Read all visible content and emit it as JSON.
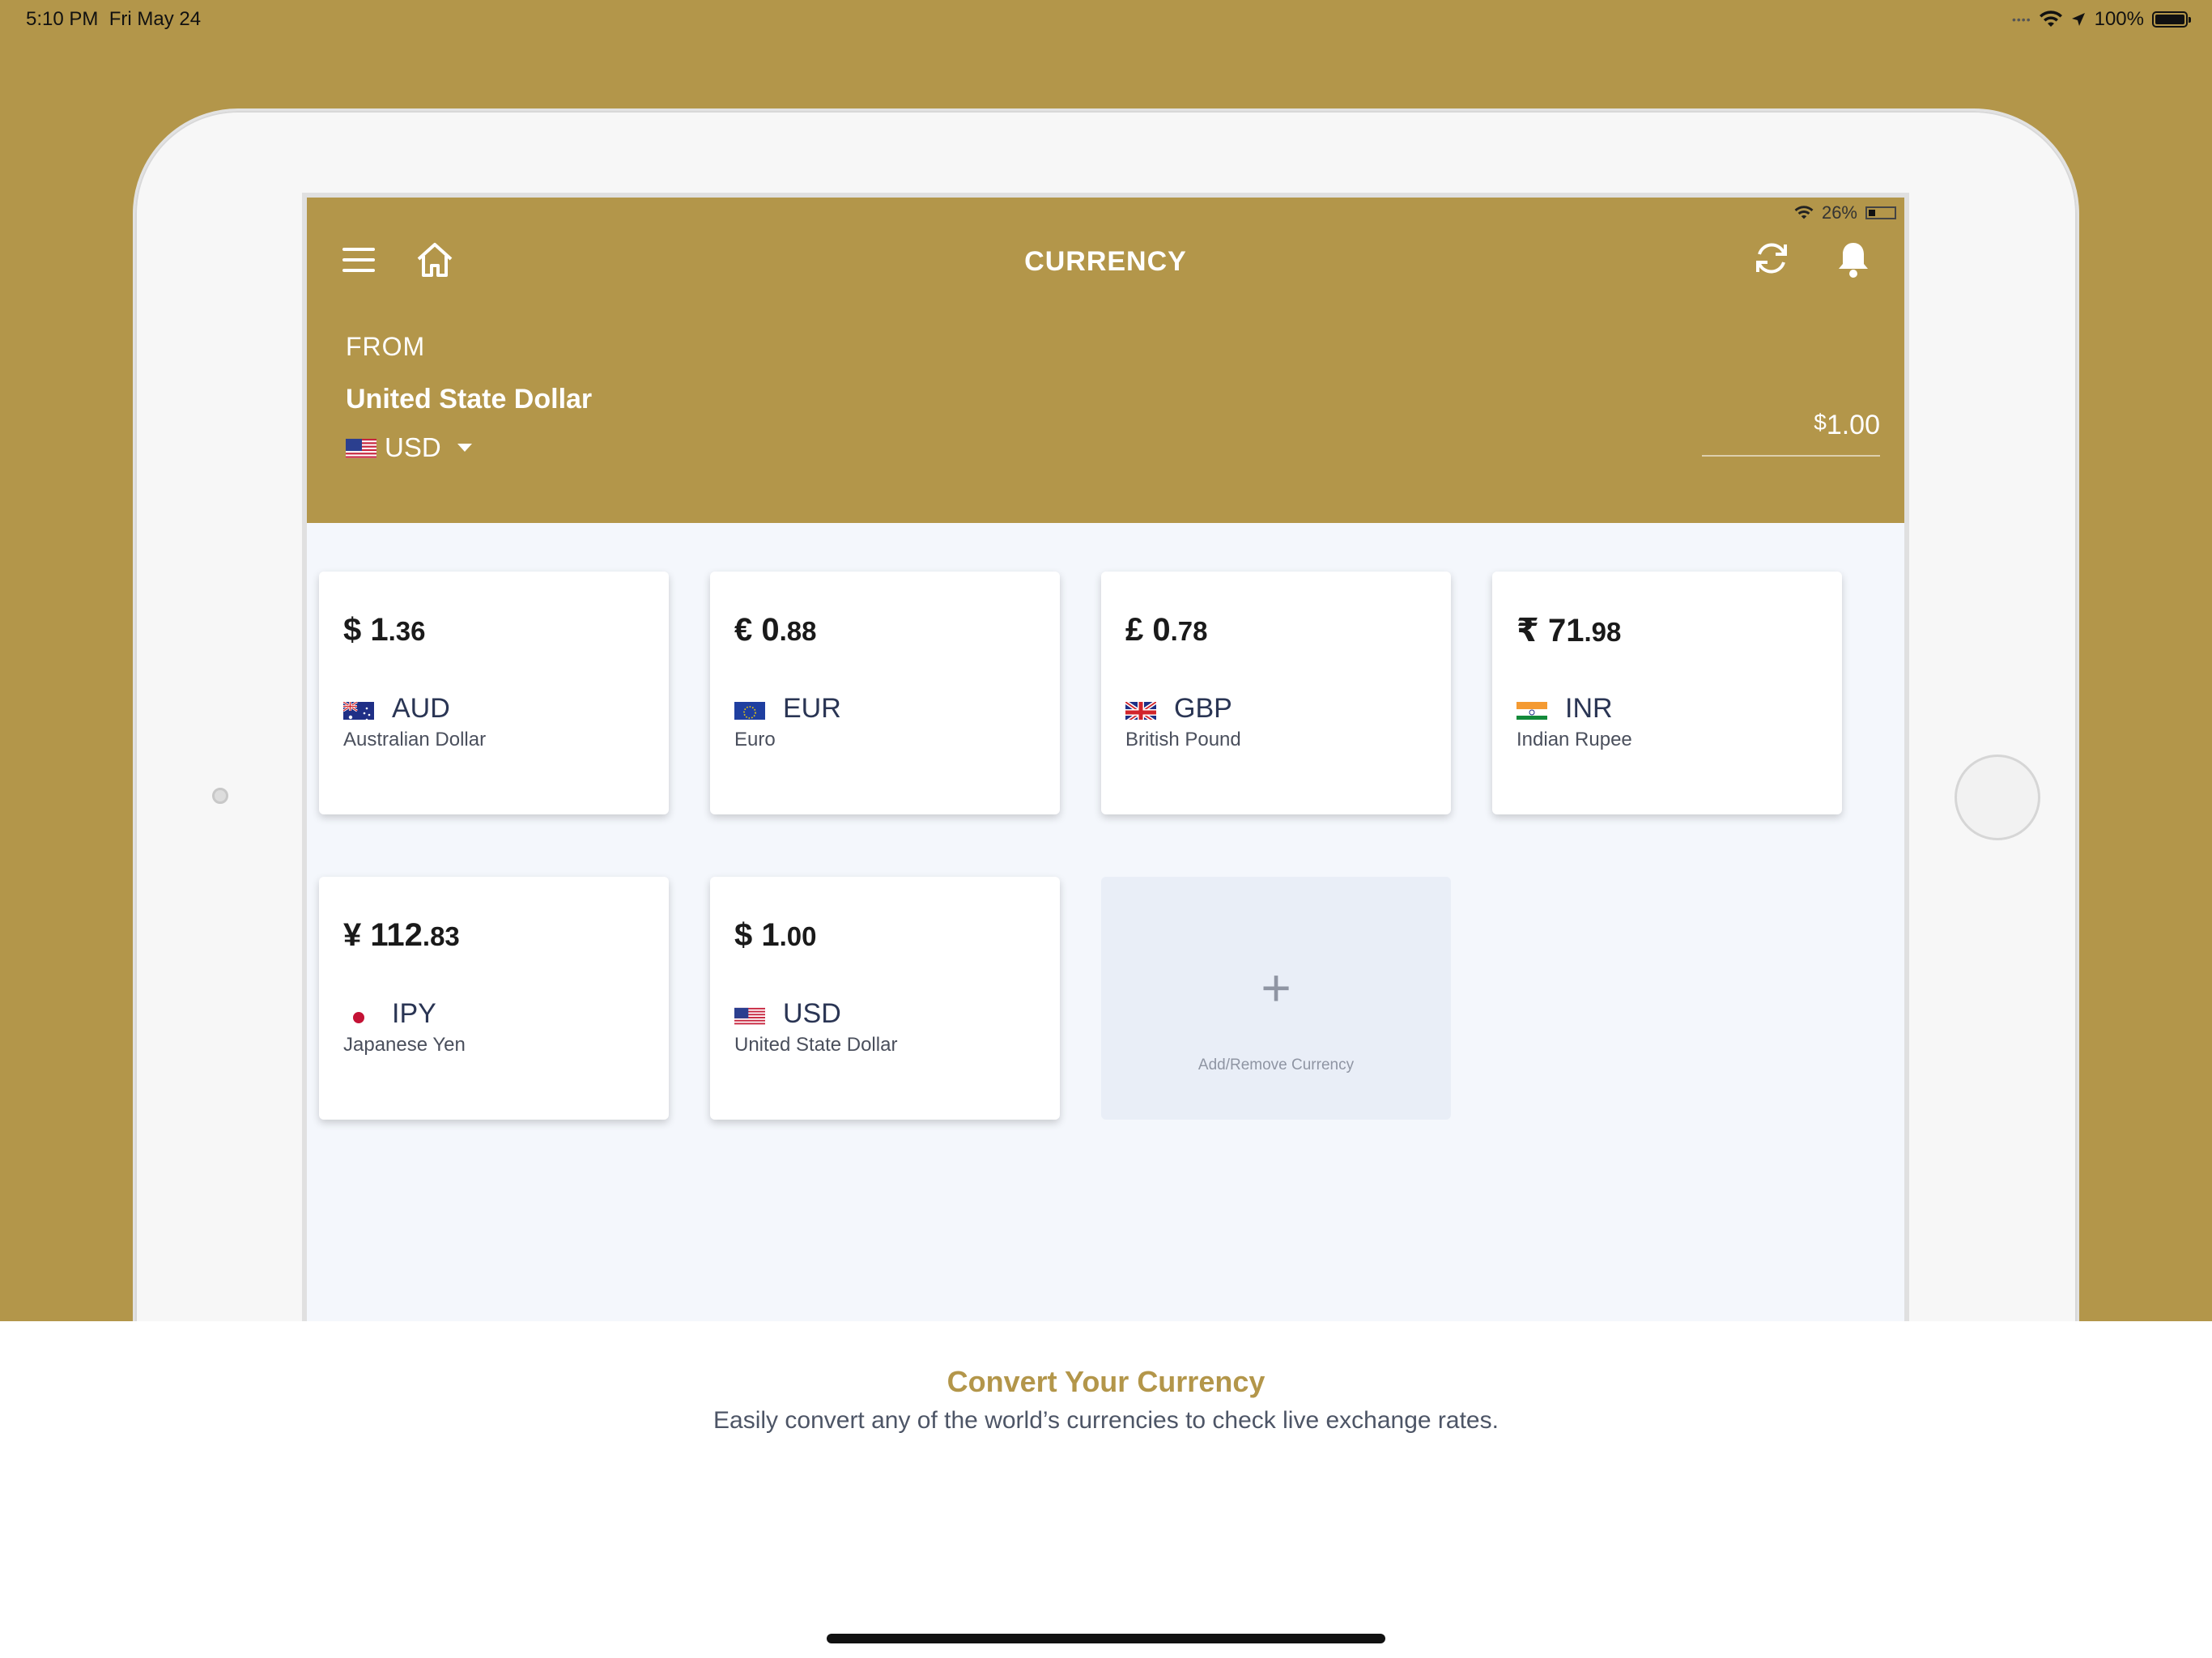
{
  "system_status": {
    "time": "5:10 PM",
    "date": "Fri May 24",
    "battery": "100%"
  },
  "app_status": {
    "battery": "26%"
  },
  "header": {
    "title": "CURRENCY"
  },
  "from": {
    "label": "FROM",
    "currency_name": "United State Dollar",
    "currency_code": "USD",
    "amount_symbol": "$",
    "amount_value": "1.00"
  },
  "cards": [
    {
      "symbol": "$",
      "whole": "1",
      "decimal": ".36",
      "code": "AUD",
      "name": "Australian Dollar",
      "flag": "australia-flag-icon"
    },
    {
      "symbol": "€",
      "whole": "0",
      "decimal": ".88",
      "code": "EUR",
      "name": "Euro",
      "flag": "eu-flag-icon"
    },
    {
      "symbol": "£",
      "whole": "0",
      "decimal": ".78",
      "code": "GBP",
      "name": "British Pound",
      "flag": "uk-flag-icon"
    },
    {
      "symbol": "₹",
      "whole": "71",
      "decimal": ".98",
      "code": "INR",
      "name": "Indian Rupee",
      "flag": "india-flag-icon"
    },
    {
      "symbol": "¥",
      "whole": "112",
      "decimal": ".83",
      "code": "IPY",
      "name": "Japanese Yen",
      "flag": "japan-flag-icon"
    },
    {
      "symbol": "$",
      "whole": "1",
      "decimal": ".00",
      "code": "USD",
      "name": "United State Dollar",
      "flag": "usa-flag-icon"
    }
  ],
  "add_card": {
    "plus": "+",
    "label": "Add/Remove Currency"
  },
  "footer": {
    "title": "Convert Your Currency",
    "subtitle": "Easily convert any of the world’s currencies to check live exchange rates."
  },
  "colors": {
    "gold": "#b3964a",
    "screen_bg": "#f4f7fc",
    "add_card_bg": "#e9eef7"
  }
}
